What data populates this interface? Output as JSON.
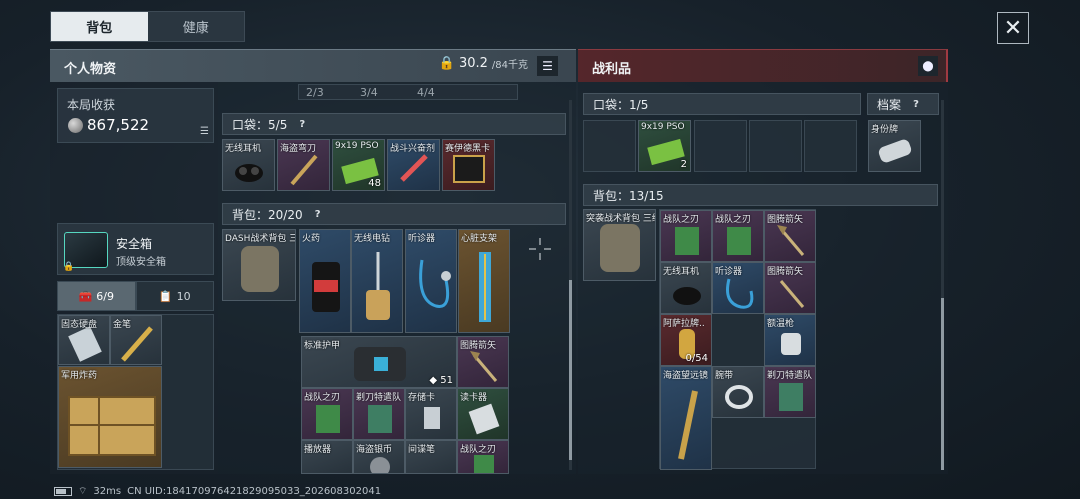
{
  "top_tabs": [
    {
      "label": "背包"
    },
    {
      "label": "健康"
    }
  ],
  "personal": {
    "title": "个人物资",
    "weight_value": "30.2",
    "weight_max": "/84千克"
  },
  "loot": {
    "title": "战利品"
  },
  "earnings": {
    "label": "本局收获",
    "value": "867,522"
  },
  "safe": {
    "name": "安全箱",
    "sub": "顶级安全箱"
  },
  "side_tabs": [
    {
      "label": "6/9"
    },
    {
      "label": "10"
    }
  ],
  "side_items": [
    {
      "name": "固态硬盘"
    },
    {
      "name": "金笔"
    },
    {
      "name": "军用炸药"
    }
  ],
  "top_counts": [
    "2/3",
    "3/4",
    "4/4"
  ],
  "pocket": {
    "label": "口袋：",
    "count": "5/5",
    "help": "?"
  },
  "pocket_items": [
    {
      "name": "无线耳机",
      "count": ""
    },
    {
      "name": "海盗弯刀",
      "count": ""
    },
    {
      "name": "9x19 PSO",
      "count": "48"
    },
    {
      "name": "战斗兴奋剂",
      "count": ""
    },
    {
      "name": "赛伊德黑卡",
      "count": ""
    }
  ],
  "backpack": {
    "label": "背包：",
    "count": "20/20",
    "help": "?"
  },
  "backpack_items": [
    {
      "name": "DASH战术背包 三级"
    },
    {
      "name": "火药"
    },
    {
      "name": "无线电钻"
    },
    {
      "name": "听诊器"
    },
    {
      "name": "心脏支架"
    },
    {
      "name": "标准护甲",
      "count": "51"
    },
    {
      "name": "图腾箭矢"
    },
    {
      "name": "战队之刃"
    },
    {
      "name": "剃刀特遣队"
    },
    {
      "name": "存储卡"
    },
    {
      "name": "读卡器"
    },
    {
      "name": "播放器"
    },
    {
      "name": "海盗银币"
    },
    {
      "name": "间谍笔"
    },
    {
      "name": "战队之刃"
    }
  ],
  "loot_pocket": {
    "label": "口袋：",
    "count": "1/5"
  },
  "loot_pocket_items": [
    {
      "name": "9x19 PSO",
      "count": "2"
    }
  ],
  "file": {
    "label": "档案",
    "help": "?"
  },
  "file_items": [
    {
      "name": "身份牌"
    }
  ],
  "loot_backpack": {
    "label": "背包：",
    "count": "13/15"
  },
  "loot_backpack_items": [
    {
      "name": "突袭战术背包 三级"
    },
    {
      "name": "战队之刃"
    },
    {
      "name": "战队之刃"
    },
    {
      "name": "图腾箭矢"
    },
    {
      "name": "无线耳机"
    },
    {
      "name": "听诊器"
    },
    {
      "name": "图腾箭矢"
    },
    {
      "name": "阿萨拉牌..",
      "count": "0/54"
    },
    {
      "name": "额温枪"
    },
    {
      "name": "海盗望远镜"
    },
    {
      "name": "腕带"
    },
    {
      "name": "剃刀特遣队"
    }
  ],
  "status": {
    "ping": "32ms",
    "uid": "CN UID:18417097642182909503З_202608302041"
  },
  "colors": {
    "accent_red": "#a03a42",
    "safe_teal": "#56d7c0"
  }
}
